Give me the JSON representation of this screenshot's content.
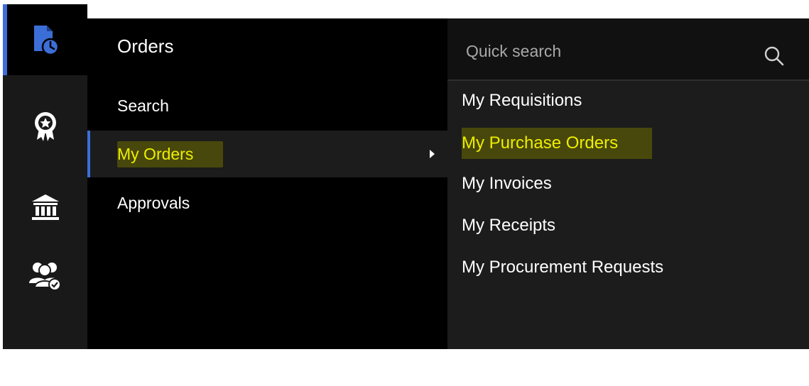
{
  "menu": {
    "title": "Orders",
    "items": [
      {
        "label": "Search"
      },
      {
        "label": "My Orders"
      },
      {
        "label": "Approvals"
      }
    ]
  },
  "submenu": {
    "search": {
      "placeholder": "Quick search"
    },
    "items": [
      {
        "label": "My Requisitions"
      },
      {
        "label": "My Purchase Orders"
      },
      {
        "label": "My Invoices"
      },
      {
        "label": "My Receipts"
      },
      {
        "label": "My Procurement Requests"
      }
    ]
  },
  "rail": {
    "icons": [
      "orders-clock-icon",
      "award-badge-icon",
      "bank-icon",
      "users-check-icon",
      "bar-chart-icon"
    ]
  },
  "colors": {
    "rail_bg": "#191919",
    "menu_bg": "#000000",
    "submenu_bg": "#1c1c1c",
    "accent": "#3c6ed8",
    "highlight_text": "#eeee00"
  }
}
